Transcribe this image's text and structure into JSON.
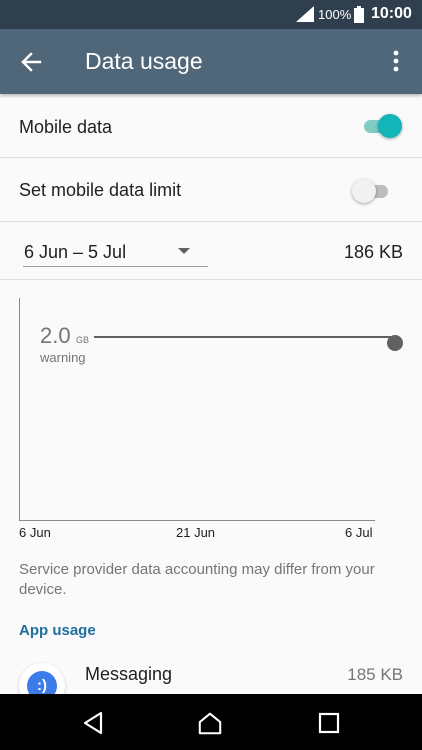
{
  "status_bar": {
    "battery_percent": "100%",
    "time": "10:00",
    "icons": [
      "signal-icon",
      "battery-icon"
    ]
  },
  "app_bar": {
    "title": "Data usage",
    "back_icon": "arrow-back-icon",
    "menu_icon": "more-vert-icon"
  },
  "settings": {
    "mobile_data": {
      "label": "Mobile data",
      "enabled": true
    },
    "data_limit": {
      "label": "Set mobile data limit",
      "enabled": false
    }
  },
  "cycle": {
    "range": "6 Jun – 5 Jul",
    "total": "186 KB"
  },
  "chart": {
    "warning_value": "2.0",
    "warning_unit": "GB",
    "warning_label": "warning",
    "x_ticks": [
      "6 Jun",
      "21 Jun",
      "6 Jul"
    ]
  },
  "note": "Service provider data accounting may differ from your device.",
  "app_usage": {
    "header": "App usage",
    "apps": [
      {
        "name": "Messaging",
        "size": "185 KB",
        "icon": "messaging-icon",
        "icon_glyph": ":)"
      }
    ]
  },
  "nav_bar": {
    "icons": [
      "nav-back-icon",
      "nav-home-icon",
      "nav-recents-icon"
    ]
  },
  "colors": {
    "status_bar": "#2f3f4e",
    "app_bar": "#4f6778",
    "accent": "#13b6b8",
    "section_header": "#1f6e9e"
  }
}
